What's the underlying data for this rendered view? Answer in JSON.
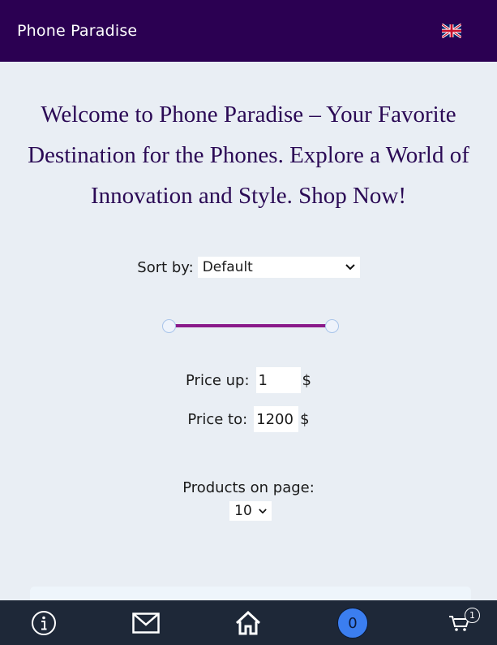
{
  "header": {
    "brand": "Phone Paradise",
    "language_icon": "uk-flag-icon"
  },
  "welcome_text": "Welcome to Phone Paradise – Your Favorite Destination for the Phones. Explore a World of Innovation and Style. Shop Now!",
  "sort": {
    "label": "Sort by:",
    "selected": "Default"
  },
  "price_range": {
    "min_fraction": 0,
    "max_fraction": 1
  },
  "price_from": {
    "label": "Price up:",
    "value": "1",
    "currency": "$"
  },
  "price_to": {
    "label": "Price to:",
    "value": "1200",
    "currency": "$"
  },
  "per_page": {
    "label": "Products on page:",
    "selected": "10"
  },
  "bottom_nav": {
    "items": [
      "info-icon",
      "mail-icon",
      "home-icon",
      "counter",
      "cart-icon"
    ],
    "counter_value": "0",
    "cart_count": "1"
  },
  "colors": {
    "header_bg": "#2b0052",
    "page_bg": "#e9eef4",
    "heading": "#2b0a55",
    "slider_track": "#8a1a8a",
    "bottom_bar": "#1e2838",
    "counter_bg": "#3b7ef0"
  }
}
